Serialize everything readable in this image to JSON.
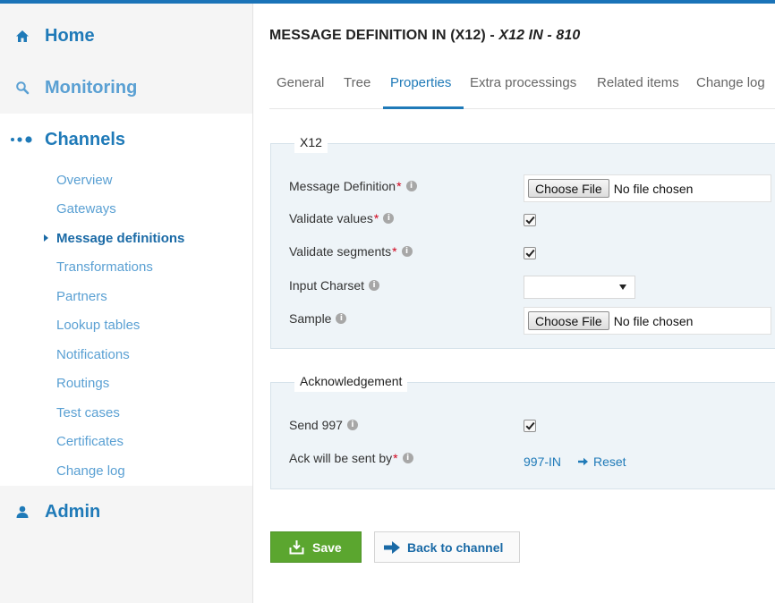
{
  "sidebar": {
    "home": "Home",
    "monitoring": "Monitoring",
    "channels": "Channels",
    "admin": "Admin",
    "channel_items": [
      "Overview",
      "Gateways",
      "Message definitions",
      "Transformations",
      "Partners",
      "Lookup tables",
      "Notifications",
      "Routings",
      "Test cases",
      "Certificates",
      "Change log"
    ],
    "active_item": "Message definitions"
  },
  "header": {
    "title_prefix": "MESSAGE DEFINITION IN (X12) - ",
    "title_italic": "X12 IN - 810"
  },
  "tabs": [
    "General",
    "Tree",
    "Properties",
    "Extra processings",
    "Related items",
    "Change log"
  ],
  "active_tab": "Properties",
  "x12_section": {
    "legend": "X12",
    "message_definition_label": "Message Definition",
    "message_definition_file_button": "Choose File",
    "message_definition_file_status": "No file chosen",
    "validate_values_label": "Validate values",
    "validate_values_checked": true,
    "validate_segments_label": "Validate segments",
    "validate_segments_checked": true,
    "input_charset_label": "Input Charset",
    "input_charset_value": "",
    "sample_label": "Sample",
    "sample_file_button": "Choose File",
    "sample_file_status": "No file chosen"
  },
  "ack_section": {
    "legend": "Acknowledgement",
    "send997_label": "Send 997",
    "send997_checked": true,
    "ack_sent_by_label": "Ack will be sent by",
    "ack_sent_by_value": "997-IN",
    "reset_label": "Reset"
  },
  "actions": {
    "save_label": "Save",
    "back_label": "Back to channel"
  },
  "colors": {
    "accent": "#1f7ab8",
    "save_green": "#5ba62f",
    "required_red": "#d0021b",
    "panel_bg": "#eef4f8"
  }
}
